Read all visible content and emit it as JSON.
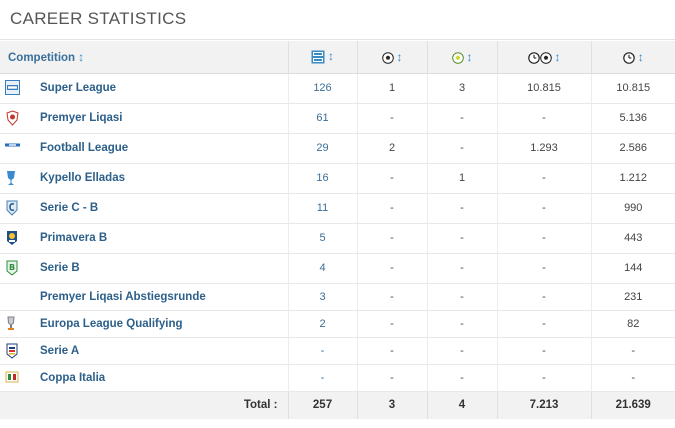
{
  "page": {
    "title": "CAREER STATISTICS"
  },
  "table": {
    "headers": {
      "competition": "Competition",
      "appearances_icon": "appearances-icon",
      "goals_icon": "goals-icon",
      "assists_icon": "assists-icon",
      "minutes_per_goal_icon": "minutes-per-goal-icon",
      "minutes_icon": "minutes-played-icon"
    },
    "rows": [
      {
        "competition": "Super League",
        "logo": "super-league-logo",
        "apps": "126",
        "goals": "1",
        "assists": "3",
        "mpg": "10.815",
        "minutes": "10.815"
      },
      {
        "competition": "Premyer Liqasi",
        "logo": "premyer-liqasi-logo",
        "apps": "61",
        "goals": "-",
        "assists": "-",
        "mpg": "-",
        "minutes": "5.136"
      },
      {
        "competition": "Football League",
        "logo": "football-league-logo",
        "apps": "29",
        "goals": "2",
        "assists": "-",
        "mpg": "1.293",
        "minutes": "2.586"
      },
      {
        "competition": "Kypello Elladas",
        "logo": "kypello-elladas-logo",
        "apps": "16",
        "goals": "-",
        "assists": "1",
        "mpg": "-",
        "minutes": "1.212"
      },
      {
        "competition": "Serie C - B",
        "logo": "serie-c-logo",
        "apps": "11",
        "goals": "-",
        "assists": "-",
        "mpg": "-",
        "minutes": "990"
      },
      {
        "competition": "Primavera B",
        "logo": "primavera-logo",
        "apps": "5",
        "goals": "-",
        "assists": "-",
        "mpg": "-",
        "minutes": "443"
      },
      {
        "competition": "Serie B",
        "logo": "serie-b-logo",
        "apps": "4",
        "goals": "-",
        "assists": "-",
        "mpg": "-",
        "minutes": "144"
      },
      {
        "competition": "Premyer Liqasi Abstiegsrunde",
        "logo": "",
        "apps": "3",
        "goals": "-",
        "assists": "-",
        "mpg": "-",
        "minutes": "231"
      },
      {
        "competition": "Europa League Qualifying",
        "logo": "europa-league-logo",
        "apps": "2",
        "goals": "-",
        "assists": "-",
        "mpg": "-",
        "minutes": "82"
      },
      {
        "competition": "Serie A",
        "logo": "serie-a-logo",
        "apps": "-",
        "goals": "-",
        "assists": "-",
        "mpg": "-",
        "minutes": "-"
      },
      {
        "competition": "Coppa Italia",
        "logo": "coppa-italia-logo",
        "apps": "-",
        "goals": "-",
        "assists": "-",
        "mpg": "-",
        "minutes": "-"
      }
    ],
    "totals": {
      "label": "Total :",
      "apps": "257",
      "goals": "3",
      "assists": "4",
      "mpg": "7.213",
      "minutes": "21.639"
    }
  },
  "colors": {
    "link": "#2c5f8a",
    "accent": "#3a8bc2",
    "header_bg": "#f2f2f2"
  }
}
